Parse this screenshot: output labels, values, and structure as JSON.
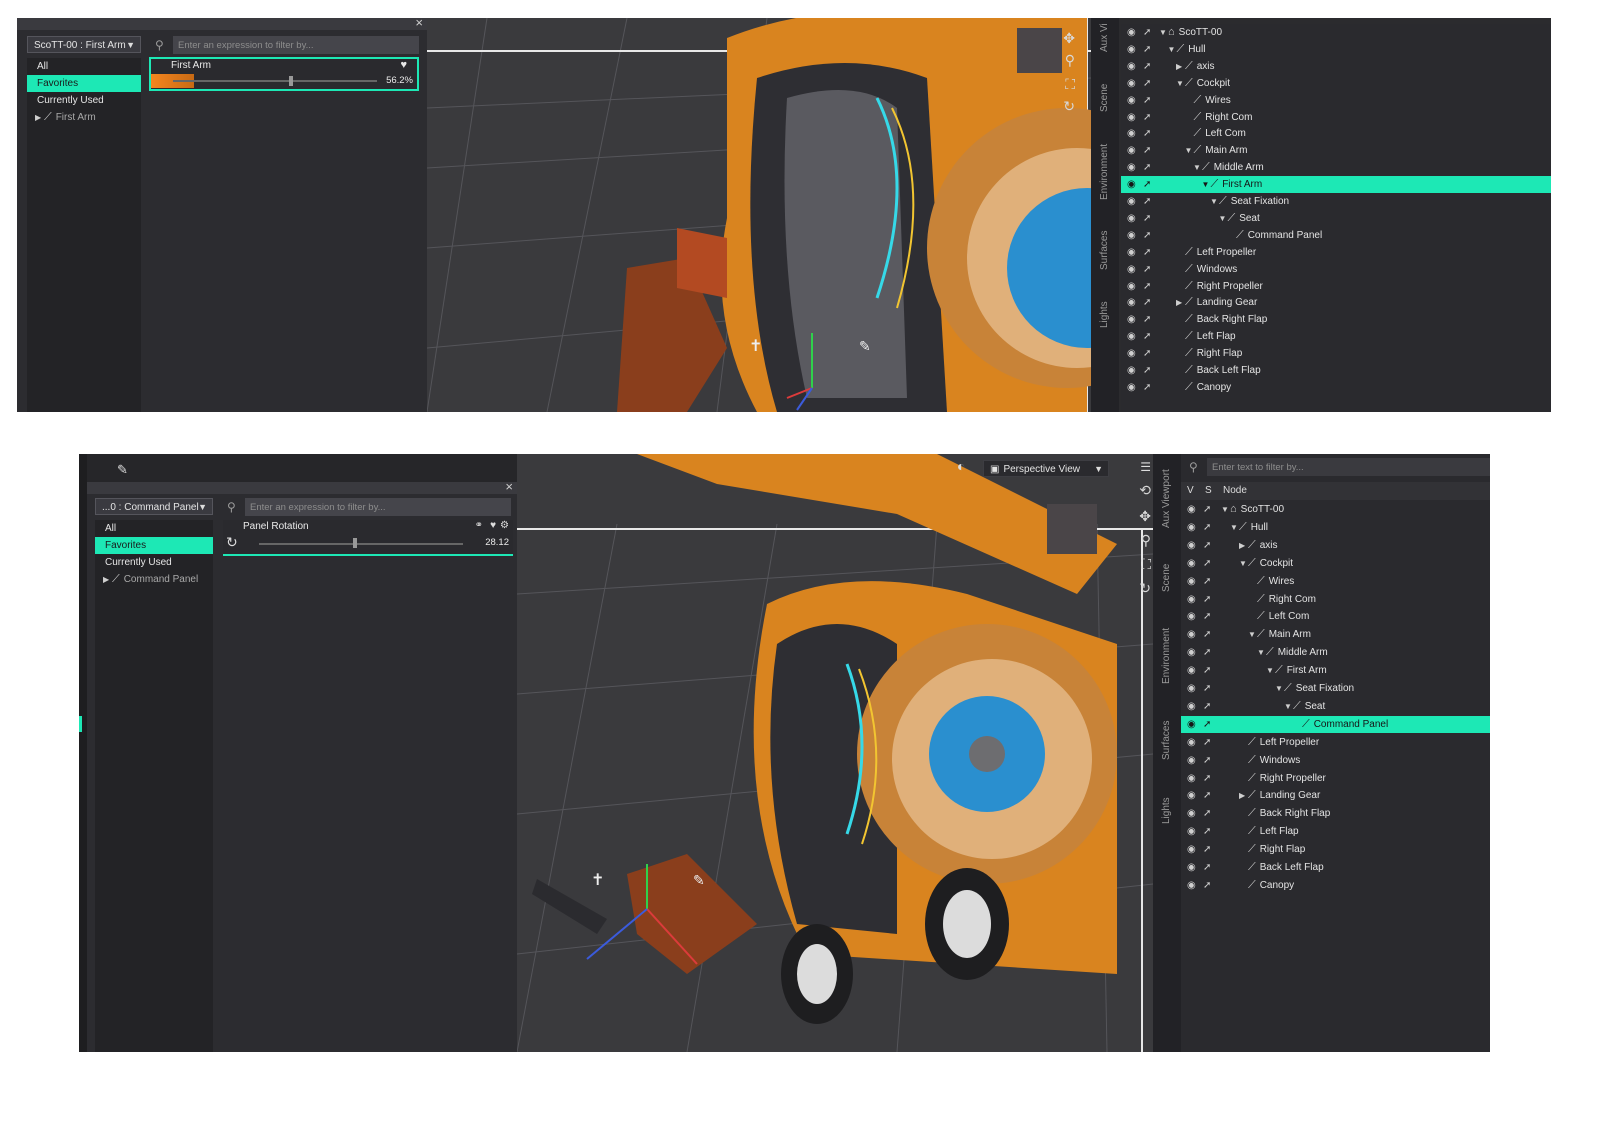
{
  "top": {
    "selector_dropdown": "ScoTT-00 : First Arm",
    "filters": [
      "All",
      "Favorites",
      "Currently Used"
    ],
    "active_filter": "Favorites",
    "node_entry": "First Arm",
    "search_placeholder": "Enter an expression to filter by...",
    "param": {
      "label": "First Arm",
      "value": "56.2%",
      "fill": 0.562
    },
    "side_tabs": [
      "Aux Vi",
      "Scene",
      "Environment",
      "Surfaces",
      "Lights"
    ],
    "tree": [
      {
        "label": "ScoTT-00",
        "depth": 0,
        "tw": "▼",
        "root": true
      },
      {
        "label": "Hull",
        "depth": 1,
        "tw": "▼"
      },
      {
        "label": "axis",
        "depth": 2,
        "tw": "▶"
      },
      {
        "label": "Cockpit",
        "depth": 2,
        "tw": "▼"
      },
      {
        "label": "Wires",
        "depth": 3,
        "tw": ""
      },
      {
        "label": "Right Com",
        "depth": 3,
        "tw": ""
      },
      {
        "label": "Left Com",
        "depth": 3,
        "tw": ""
      },
      {
        "label": "Main Arm",
        "depth": 3,
        "tw": "▼"
      },
      {
        "label": "Middle Arm",
        "depth": 4,
        "tw": "▼"
      },
      {
        "label": "First Arm",
        "depth": 5,
        "tw": "▼",
        "sel": true
      },
      {
        "label": "Seat Fixation",
        "depth": 6,
        "tw": "▼"
      },
      {
        "label": "Seat",
        "depth": 7,
        "tw": "▼"
      },
      {
        "label": "Command Panel",
        "depth": 8,
        "tw": ""
      },
      {
        "label": "Left Propeller",
        "depth": 2,
        "tw": ""
      },
      {
        "label": "Windows",
        "depth": 2,
        "tw": ""
      },
      {
        "label": "Right Propeller",
        "depth": 2,
        "tw": ""
      },
      {
        "label": "Landing Gear",
        "depth": 2,
        "tw": "▶"
      },
      {
        "label": "Back Right Flap",
        "depth": 2,
        "tw": ""
      },
      {
        "label": "Left Flap",
        "depth": 2,
        "tw": ""
      },
      {
        "label": "Right Flap",
        "depth": 2,
        "tw": ""
      },
      {
        "label": "Back Left Flap",
        "depth": 2,
        "tw": ""
      },
      {
        "label": "Canopy",
        "depth": 2,
        "tw": ""
      }
    ]
  },
  "bottom": {
    "selector_dropdown": "...0 : Command Panel",
    "filters": [
      "All",
      "Favorites",
      "Currently Used"
    ],
    "active_filter": "Favorites",
    "node_entry": "Command Panel",
    "search_placeholder": "Enter an expression to filter by...",
    "param": {
      "label": "Panel Rotation",
      "value": "28.12",
      "fill": 0.56
    },
    "view_dropdown": "Perspective View",
    "tree_search_placeholder": "Enter text to filter by...",
    "tree_headers": {
      "v": "V",
      "s": "S",
      "node": "Node"
    },
    "side_tabs": [
      "Aux Viewport",
      "Scene",
      "Environment",
      "Surfaces",
      "Lights"
    ],
    "tree": [
      {
        "label": "ScoTT-00",
        "depth": 0,
        "tw": "▼",
        "root": true
      },
      {
        "label": "Hull",
        "depth": 1,
        "tw": "▼"
      },
      {
        "label": "axis",
        "depth": 2,
        "tw": "▶"
      },
      {
        "label": "Cockpit",
        "depth": 2,
        "tw": "▼"
      },
      {
        "label": "Wires",
        "depth": 3,
        "tw": ""
      },
      {
        "label": "Right Com",
        "depth": 3,
        "tw": ""
      },
      {
        "label": "Left Com",
        "depth": 3,
        "tw": ""
      },
      {
        "label": "Main Arm",
        "depth": 3,
        "tw": "▼"
      },
      {
        "label": "Middle Arm",
        "depth": 4,
        "tw": "▼"
      },
      {
        "label": "First Arm",
        "depth": 5,
        "tw": "▼"
      },
      {
        "label": "Seat Fixation",
        "depth": 6,
        "tw": "▼"
      },
      {
        "label": "Seat",
        "depth": 7,
        "tw": "▼"
      },
      {
        "label": "Command Panel",
        "depth": 8,
        "tw": "",
        "sel": true
      },
      {
        "label": "Left Propeller",
        "depth": 2,
        "tw": ""
      },
      {
        "label": "Windows",
        "depth": 2,
        "tw": ""
      },
      {
        "label": "Right Propeller",
        "depth": 2,
        "tw": ""
      },
      {
        "label": "Landing Gear",
        "depth": 2,
        "tw": "▶"
      },
      {
        "label": "Back Right Flap",
        "depth": 2,
        "tw": ""
      },
      {
        "label": "Left Flap",
        "depth": 2,
        "tw": ""
      },
      {
        "label": "Right Flap",
        "depth": 2,
        "tw": ""
      },
      {
        "label": "Back Left Flap",
        "depth": 2,
        "tw": ""
      },
      {
        "label": "Canopy",
        "depth": 2,
        "tw": ""
      }
    ]
  },
  "colors": {
    "accent": "#1de8b5",
    "slider_orange": "#f08a2a",
    "panel_bg": "#2c2c30",
    "model_orange": "#d9841f",
    "model_blue": "#2a8fcf"
  },
  "icons": [
    "search-icon",
    "close-icon",
    "heart-icon",
    "eye-icon",
    "select-cursor-icon",
    "bone-icon",
    "figure-icon",
    "move-icon",
    "zoom-icon",
    "frame-icon",
    "orbit-icon",
    "gear-icon",
    "rotate-icon",
    "link-icon"
  ]
}
